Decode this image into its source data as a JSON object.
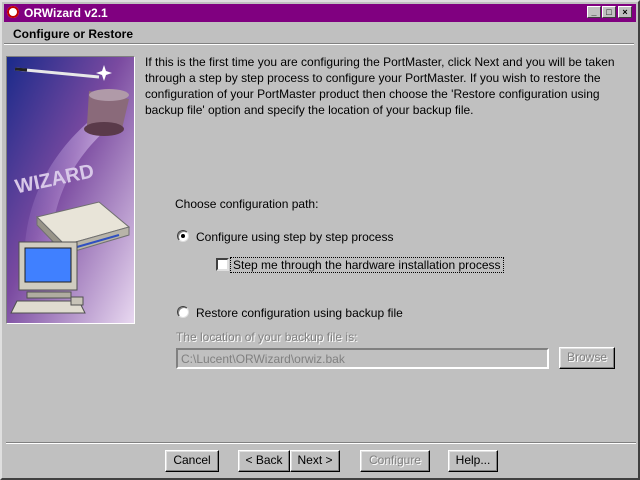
{
  "window": {
    "title": "ORWizard v2.1",
    "controls": {
      "minimize": "_",
      "maximize": "□",
      "close": "×"
    }
  },
  "header": {
    "title": "Configure or Restore"
  },
  "illustration": {
    "label": "WIZARD"
  },
  "intro_text": "If this is the first time you are configuring the PortMaster, click Next and you will be taken through a step by step process to configure your PortMaster.  If you wish to restore the configuration of your PortMaster product then choose the 'Restore configuration using backup file' option and specify the location of your backup file.",
  "options": {
    "heading": "Choose configuration path:",
    "step_by_step": {
      "label": "Configure using step by step process",
      "selected": true
    },
    "hardware_step": {
      "label": "Step me through the hardware installation process",
      "checked": false
    },
    "restore": {
      "label": "Restore configuration using backup file",
      "selected": false
    }
  },
  "backup": {
    "location_label": "The location of your backup file is:",
    "path_value": "C:\\Lucent\\ORWizard\\orwiz.bak",
    "browse_label": "Browse"
  },
  "footer": {
    "cancel": "Cancel",
    "back": "< Back",
    "next": "Next >",
    "configure": "Configure",
    "help": "Help..."
  }
}
